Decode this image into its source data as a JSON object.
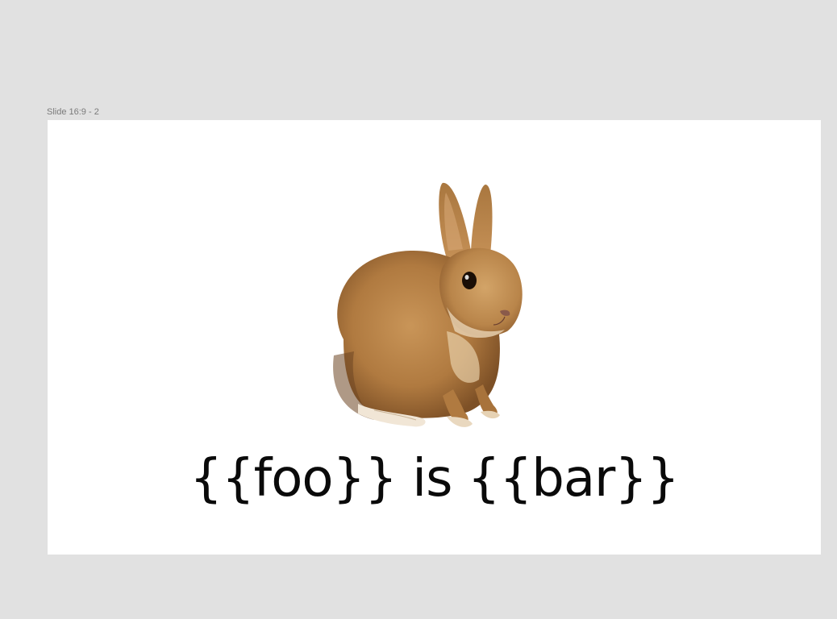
{
  "frame": {
    "label": "Slide 16:9 - 2"
  },
  "slide": {
    "caption": "{{foo}} is {{bar}}",
    "image": {
      "icon": "rabbit-image",
      "colors": {
        "fur": "#b9854a",
        "fur_dark": "#8a5a2c",
        "fur_light": "#dcb27e",
        "belly": "#efe4d2"
      }
    }
  },
  "colors": {
    "canvas_bg": "#e1e1e1",
    "slide_bg": "#ffffff",
    "label_text": "#7a7a7a",
    "caption_text": "#0a0a0a"
  }
}
